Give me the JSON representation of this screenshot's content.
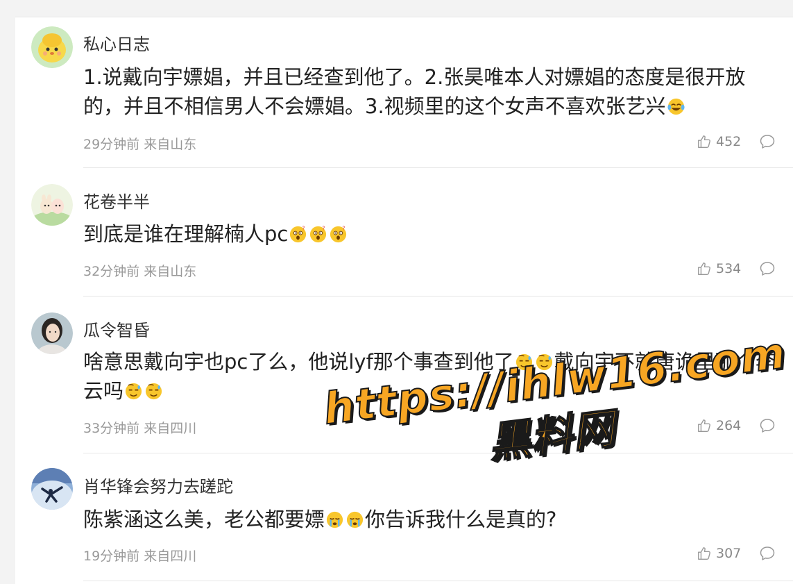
{
  "comments": [
    {
      "username": "私心日志",
      "text_parts": [
        "1.说戴向宇嫖娼，并且已经查到他了。2.张昊唯本人对嫖娼的态度是很开放的，并且不相信男人不会嫖娼。3.视频里的这个女声不喜欢张艺兴"
      ],
      "emoji_trailing": [
        "laugh-cry-emoji"
      ],
      "time": "29分钟前",
      "location": "来自山东",
      "likes": "452"
    },
    {
      "username": "花卷半半",
      "text": "到底是谁在理解楠人pc",
      "emoji_trailing": [
        "surprised-emoji",
        "surprised-emoji",
        "surprised-emoji"
      ],
      "time": "32分钟前",
      "location": "来自山东",
      "likes": "534"
    },
    {
      "username": "瓜令智昏",
      "text_a": "啥意思戴向宇也pc了么，他说lyf那个事查到他了",
      "text_b": "戴向宇不就唐诡里那个李云吗",
      "emoji_mid": [
        "sweat-emoji",
        "sweat-emoji"
      ],
      "emoji_trailing": [
        "sweat-emoji",
        "sweat-emoji"
      ],
      "time": "33分钟前",
      "location": "来自四川",
      "likes": "264"
    },
    {
      "username": "肖华锋会努力去蹉跎",
      "text_a": "陈紫涵这么美，老公都要嫖",
      "text_b": "你告诉我什么是真的?",
      "emoji_mid": [
        "crying-emoji",
        "crying-emoji"
      ],
      "time": "19分钟前",
      "location": "来自四川",
      "likes": "307"
    }
  ],
  "watermark": {
    "url": "https://ihlw16.com",
    "name": "黑料网"
  },
  "colors": {
    "background": "#ffffff",
    "gutter": "#f3f3f3",
    "meta_text": "#999999",
    "watermark_fill": "#f7a623"
  }
}
